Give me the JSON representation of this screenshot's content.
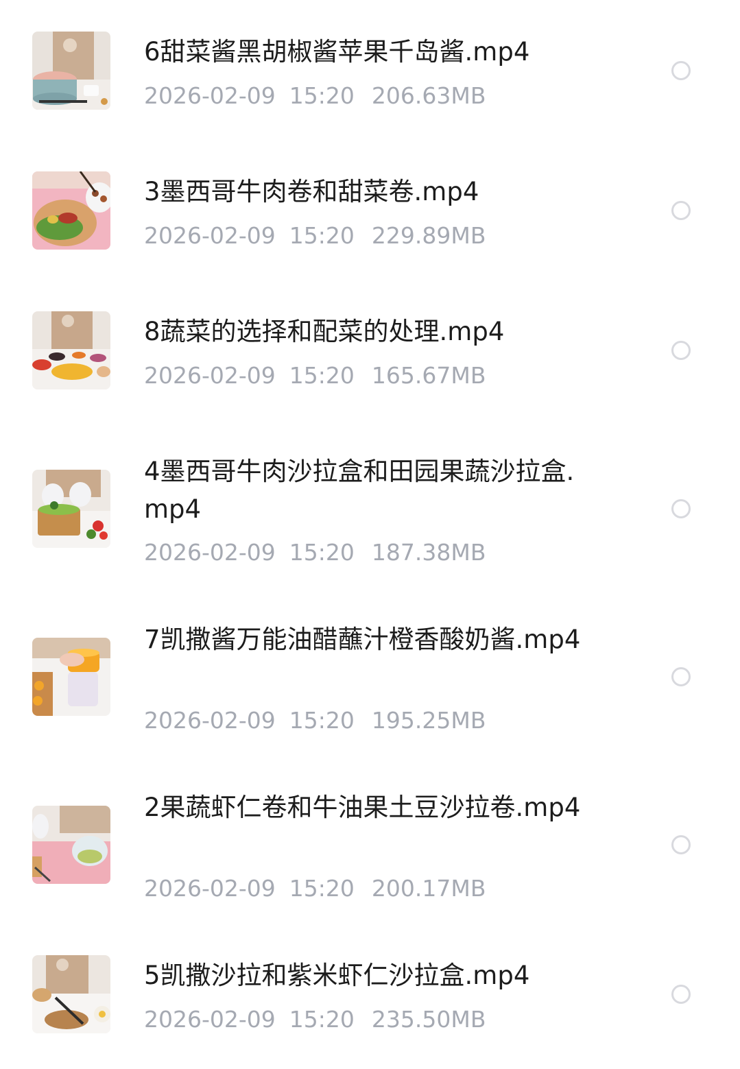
{
  "files": [
    {
      "name": "6甜菜酱黑胡椒酱苹果千岛酱.mp4",
      "date": "2026-02-09",
      "time": "15:20",
      "size": "206.63MB"
    },
    {
      "name": "3墨西哥牛肉卷和甜菜卷.mp4",
      "date": "2026-02-09",
      "time": "15:20",
      "size": "229.89MB"
    },
    {
      "name": "8蔬菜的选择和配菜的处理.mp4",
      "date": "2026-02-09",
      "time": "15:20",
      "size": "165.67MB"
    },
    {
      "name": "4墨西哥牛肉沙拉盒和田园果蔬沙拉盒.mp4",
      "date": "2026-02-09",
      "time": "15:20",
      "size": "187.38MB"
    },
    {
      "name": "7凯撒酱万能油醋蘸汁橙香酸奶酱.mp4",
      "date": "2026-02-09",
      "time": "15:20",
      "size": "195.25MB"
    },
    {
      "name": "2果蔬虾仁卷和牛油果土豆沙拉卷.mp4",
      "date": "2026-02-09",
      "time": "15:20",
      "size": "200.17MB"
    },
    {
      "name": "5凯撒沙拉和紫米虾仁沙拉盒.mp4",
      "date": "2026-02-09",
      "time": "15:20",
      "size": "235.50MB"
    }
  ]
}
